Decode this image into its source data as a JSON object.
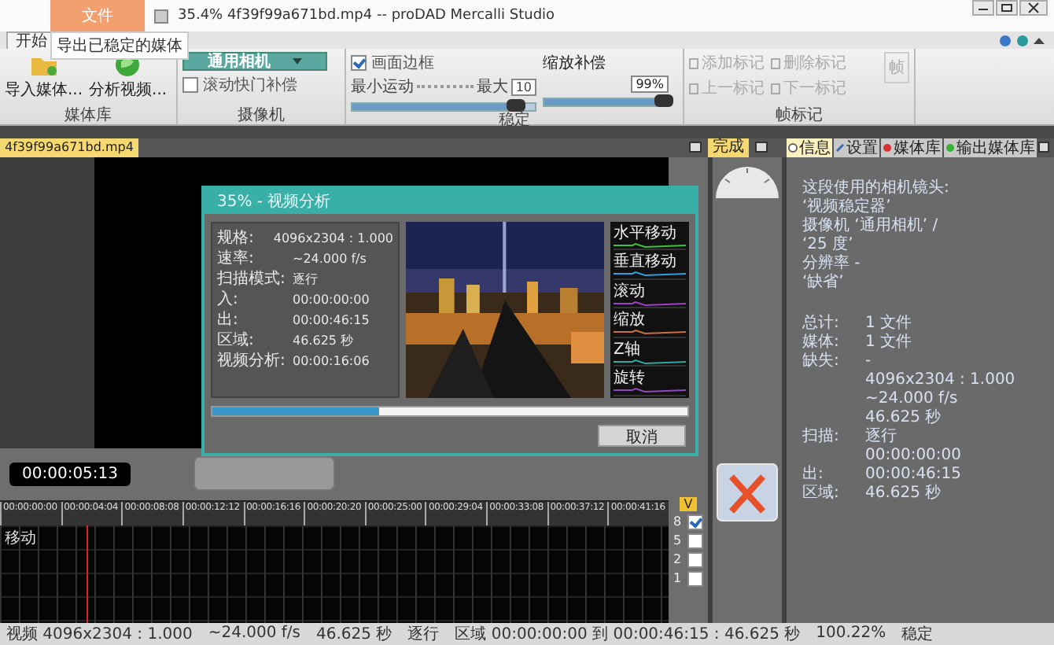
{
  "window": {
    "title": "35.4%  4f39f99a671bd.mp4 -- proDAD Mercalli Studio"
  },
  "app_menu": {
    "label": "文件",
    "items": [
      "导出已稳定的媒体"
    ]
  },
  "ribbon_tabs": [
    {
      "label": "开始",
      "selected": true
    }
  ],
  "media_group": {
    "label": "媒体库",
    "buttons": [
      "导入媒体...",
      "分析视频..."
    ]
  },
  "camera_group": {
    "label": "摄像机",
    "select": "通用相机",
    "checkbox": {
      "label": "滚动快门补偿",
      "checked": false
    }
  },
  "stabilize_group": {
    "label": "稳定",
    "checkbox": {
      "label": "画面边框",
      "checked": true
    },
    "slider1": {
      "min_label": "最小运动",
      "max_label": "最大",
      "value": "10",
      "level": 0.9
    },
    "slider2": {
      "label": "缩放补偿",
      "value": "99%",
      "level": 0.97
    }
  },
  "markers_group": {
    "label": "帧标记",
    "buttons": [
      {
        "label": "添加标记",
        "disabled": true
      },
      {
        "label": "删除标记",
        "disabled": true
      },
      {
        "label": "上一标记",
        "disabled": true
      },
      {
        "label": "下一标记",
        "disabled": true
      }
    ],
    "extra_button": {
      "label": "帧",
      "disabled": true
    }
  },
  "file_tabs": [
    {
      "label": "4f39f99a671bd.mp4",
      "selected": true
    }
  ],
  "center_tabs": [
    {
      "label": "完成",
      "selected": true
    }
  ],
  "panel_tabs": [
    {
      "label": "信息",
      "selected": true
    },
    {
      "label": "设置",
      "selected": false
    },
    {
      "label": "媒体库",
      "selected": false
    },
    {
      "label": "输出媒体库",
      "selected": false
    }
  ],
  "dialog": {
    "title": "35% - 视频分析",
    "info": [
      {
        "label": "规格:",
        "value": "4096x2304 : 1.000"
      },
      {
        "label": "速率:",
        "value": "~24.000 f/s"
      },
      {
        "label": "扫描模式:",
        "value": "逐行"
      },
      {
        "label": "入:",
        "value": "00:00:00:00"
      },
      {
        "label": "出:",
        "value": "00:00:46:15"
      },
      {
        "label": "区域:",
        "value": "46.625 秒"
      },
      {
        "label": "视频分析:",
        "value": "00:00:16:06"
      }
    ],
    "graphs": [
      {
        "label": "水平移动",
        "color": "#3cc43c"
      },
      {
        "label": "垂直移动",
        "color": "#2e9fe0"
      },
      {
        "label": "滚动",
        "color": "#a040c8"
      },
      {
        "label": "缩放",
        "color": "#c87040"
      },
      {
        "label": "Z轴",
        "color": "#30a8a0"
      },
      {
        "label": "旋转",
        "color": "#9048c0"
      }
    ],
    "progress": {
      "level": 0.35
    },
    "cancel": "取消"
  },
  "info_panel": {
    "lines": [
      "这段使用的相机镜头:",
      "‘视频稳定器’",
      "摄像机 ‘通用相机’ /",
      "‘25 度’",
      "分辨率 -",
      "‘缺省’"
    ],
    "rows": [
      {
        "label": "总计:",
        "value": "1 文件"
      },
      {
        "label": "媒体:",
        "value": "1 文件"
      },
      {
        "label": "缺失:",
        "value": "-"
      },
      {
        "value": "4096x2304 : 1.000"
      },
      {
        "value": "~24.000 f/s"
      },
      {
        "value": "46.625 秒"
      },
      {
        "label": "扫描:",
        "value": "逐行"
      },
      {
        "value": "00:00:00:00"
      },
      {
        "label": "出:",
        "value": "00:00:46:15"
      },
      {
        "label": "区域:",
        "value": "46.625 秒"
      }
    ]
  },
  "timecode": "00:00:05:13",
  "tracks": {
    "header": "V",
    "items": [
      {
        "label": "8",
        "checked": true
      },
      {
        "label": "5",
        "checked": false
      },
      {
        "label": "2",
        "checked": false
      },
      {
        "label": "1",
        "checked": false
      }
    ]
  },
  "timeline": {
    "ticks": [
      "00:00:00:00",
      "00:00:04:04",
      "00:00:08:08",
      "00:00:12:12",
      "00:00:16:16",
      "00:00:20:20",
      "00:00:25:00",
      "00:00:29:04",
      "00:00:33:08",
      "00:00:37:12",
      "00:00:41:16"
    ],
    "graph_label": "移动"
  },
  "status_bar": [
    "视频 4096x2304 : 1.000",
    "~24.000 f/s",
    "46.625 秒",
    "逐行",
    "区域 00:00:00:00 到 00:00:46:15 : 46.625 秒",
    "100.22%",
    "稳定"
  ]
}
